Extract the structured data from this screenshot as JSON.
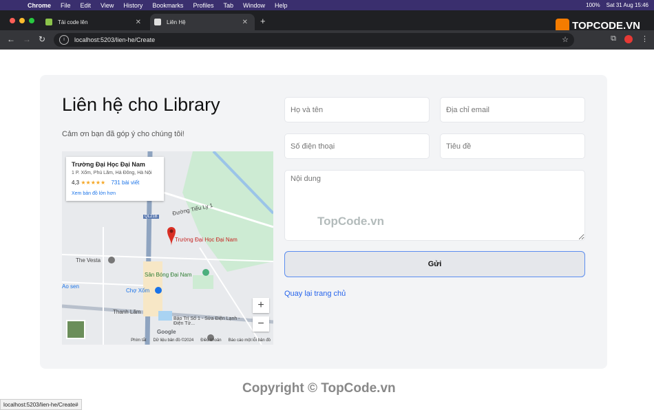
{
  "menubar": {
    "app": "Chrome",
    "items": [
      "File",
      "Edit",
      "View",
      "History",
      "Bookmarks",
      "Profiles",
      "Tab",
      "Window",
      "Help"
    ],
    "battery": "100%",
    "clock": "Sat 31 Aug  15:46"
  },
  "tabs": [
    {
      "title": "Tải code lên"
    },
    {
      "title": "Liên Hệ"
    }
  ],
  "address": {
    "url": "localhost:5203/lien-he/Create"
  },
  "logo": {
    "text": "TOPCODE.VN"
  },
  "contact": {
    "title": "Liên hệ cho Library",
    "subtitle": "Cảm ơn bạn đã góp ý cho chúng tôi!",
    "fields": {
      "name_placeholder": "Họ và tên",
      "email_placeholder": "Địa chỉ email",
      "phone_placeholder": "Số điện thoại",
      "subject_placeholder": "Tiêu đề",
      "message_placeholder": "Nội dung"
    },
    "submit_label": "Gửi",
    "back_link": "Quay lại trang chủ"
  },
  "map": {
    "place_name": "Trường Đại Học Đại Nam",
    "address": "1 P. Xốm, Phú Lãm, Hà Đông, Hà Nội",
    "rating": "4,3",
    "stars": "★★★★★",
    "reviews": "731 bài viết",
    "larger_map_link": "Xem bản đồ lớn hơn",
    "pin_label": "Trường Đại Học Đại Nam",
    "labels": [
      "The Vesta",
      "Sân Bóng Đại Nam",
      "Chợ Xốm",
      "Thanh Lãm",
      "Ao sen",
      "Đường Tiểu Ly 1",
      "Bảo Trì Số 1 - Sửa Điện Lạnh - Điện Tử...",
      "QL21B",
      "Google"
    ],
    "footer": [
      "Phím tắt",
      "Dữ liệu bản đồ ©2024",
      "Điều khoản",
      "Báo cáo một lỗi bản đồ"
    ]
  },
  "watermark": "TopCode.vn",
  "copyright": "Copyright © TopCode.vn",
  "status_url": "localhost:5203/lien-he/Create#"
}
